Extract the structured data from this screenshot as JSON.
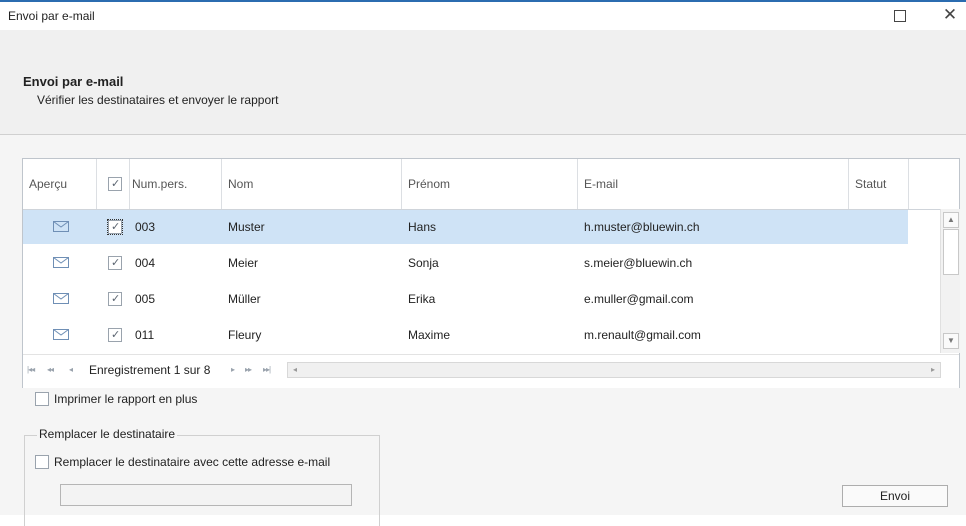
{
  "window": {
    "title": "Envoi par e-mail",
    "maximize_icon": "maximize-icon",
    "close_icon": "close-icon",
    "close_glyph": "✕"
  },
  "header": {
    "title": "Envoi par e-mail",
    "subtitle": "Vérifier les destinataires et envoyer le rapport"
  },
  "grid": {
    "columns": {
      "apercu": "Aperçu",
      "num": "Num.pers.",
      "nom": "Nom",
      "prenom": "Prénom",
      "email": "E-mail",
      "statut": "Statut"
    },
    "header_checked": true,
    "rows": [
      {
        "num": "003",
        "nom": "Muster",
        "prenom": "Hans",
        "email": "h.muster@bluewin.ch",
        "statut": "",
        "checked": true,
        "selected": true
      },
      {
        "num": "004",
        "nom": "Meier",
        "prenom": "Sonja",
        "email": "s.meier@bluewin.ch",
        "statut": "",
        "checked": true,
        "selected": false
      },
      {
        "num": "005",
        "nom": "Müller",
        "prenom": "Erika",
        "email": "e.muller@gmail.com",
        "statut": "",
        "checked": true,
        "selected": false
      },
      {
        "num": "011",
        "nom": "Fleury",
        "prenom": "Maxime",
        "email": "m.renault@gmail.com",
        "statut": "",
        "checked": true,
        "selected": false
      }
    ],
    "navigator": {
      "record_text": "Enregistrement 1 sur 8",
      "first": "|◂◂",
      "prev_page": "◂◂",
      "prev": "◂",
      "next": "▸",
      "next_page": "▸▸",
      "last": "▸▸|"
    }
  },
  "options": {
    "print_label": "Imprimer le rapport en plus",
    "print_checked": false,
    "replace_group_label": "Remplacer le destinataire",
    "replace_label": "Remplacer le destinataire avec cette adresse e-mail",
    "replace_checked": false,
    "replace_value": ""
  },
  "actions": {
    "send_label": "Envoi"
  },
  "colors": {
    "accent": "#2b6cb0",
    "selected_row": "#cfe3f6",
    "mail_icon": "#6f8fb5"
  }
}
